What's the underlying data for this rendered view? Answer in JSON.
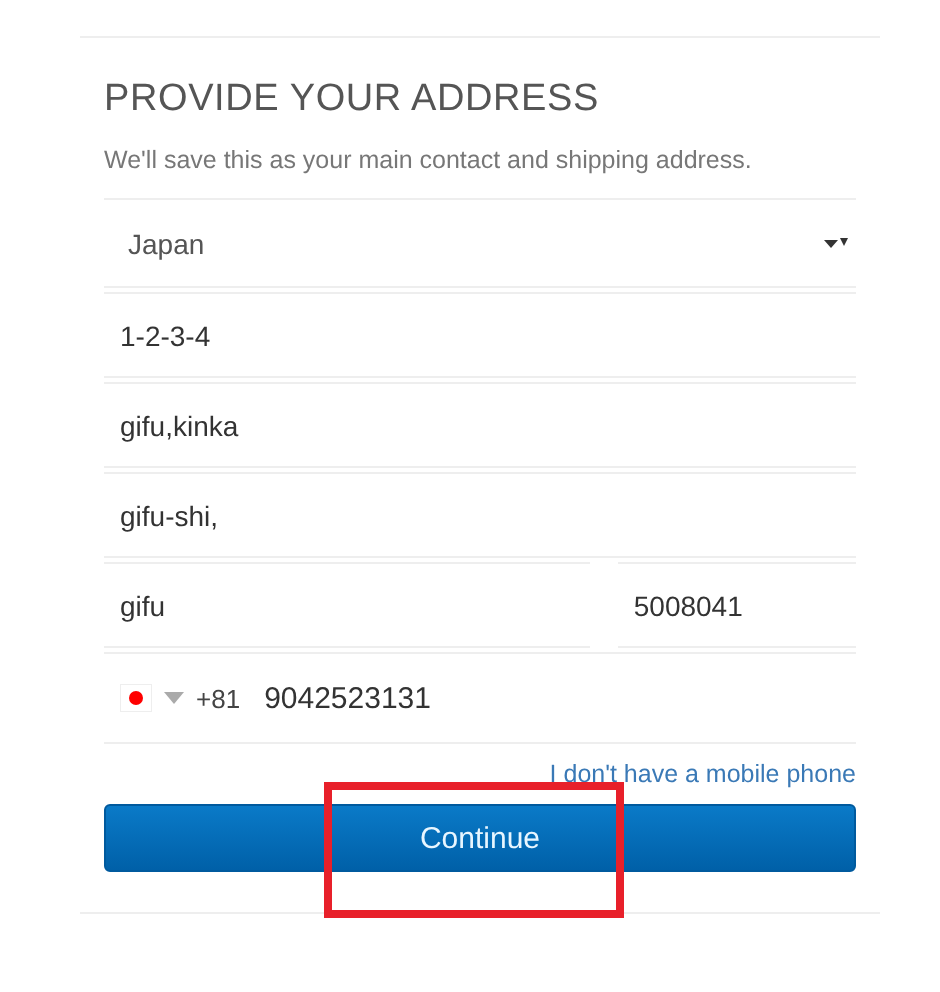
{
  "title": "PROVIDE YOUR ADDRESS",
  "subtitle": "We'll save this as your main contact and shipping address.",
  "country": {
    "value": "Japan"
  },
  "fields": [
    {
      "value": "1-2-3-4"
    },
    {
      "value": "gifu,kinka"
    },
    {
      "value": "gifu-shi,"
    }
  ],
  "city": {
    "value": "gifu"
  },
  "postal_code": {
    "value": "5008041"
  },
  "phone": {
    "code": "+81",
    "value": "9042523131"
  },
  "no_phone_link": "I don't have a mobile phone",
  "continue_button": "Continue"
}
